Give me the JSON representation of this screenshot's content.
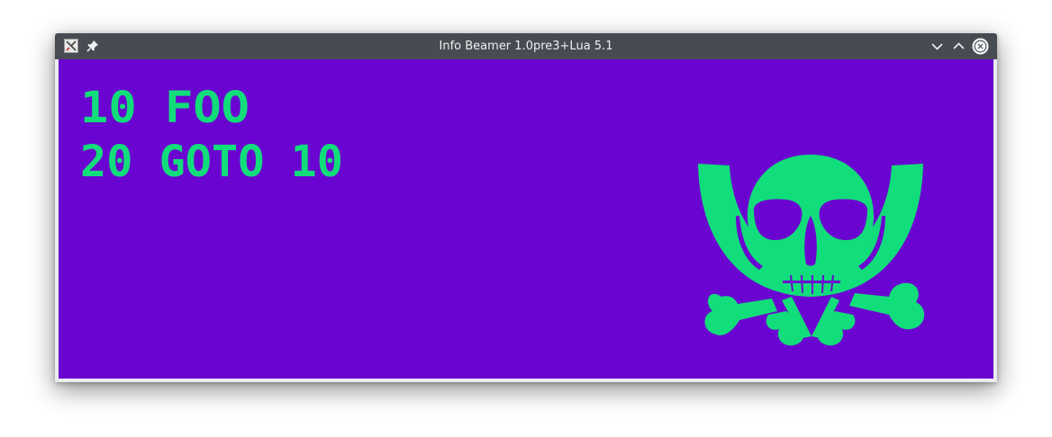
{
  "window": {
    "title": "Info Beamer 1.0pre3+Lua 5.1"
  },
  "titlebar_icons": {
    "app": "app-icon",
    "pin": "pin-icon",
    "minimize": "chevron-down-icon",
    "maximize": "chevron-up-icon",
    "close": "close-icon"
  },
  "content": {
    "background": "#6a04d0",
    "text_color": "#12dd7b",
    "code_lines": [
      "10 FOO",
      "20 GOTO 10"
    ]
  },
  "logo": {
    "icon": "skull-crossbones-posthorn-logo",
    "color": "#12dd7b"
  }
}
